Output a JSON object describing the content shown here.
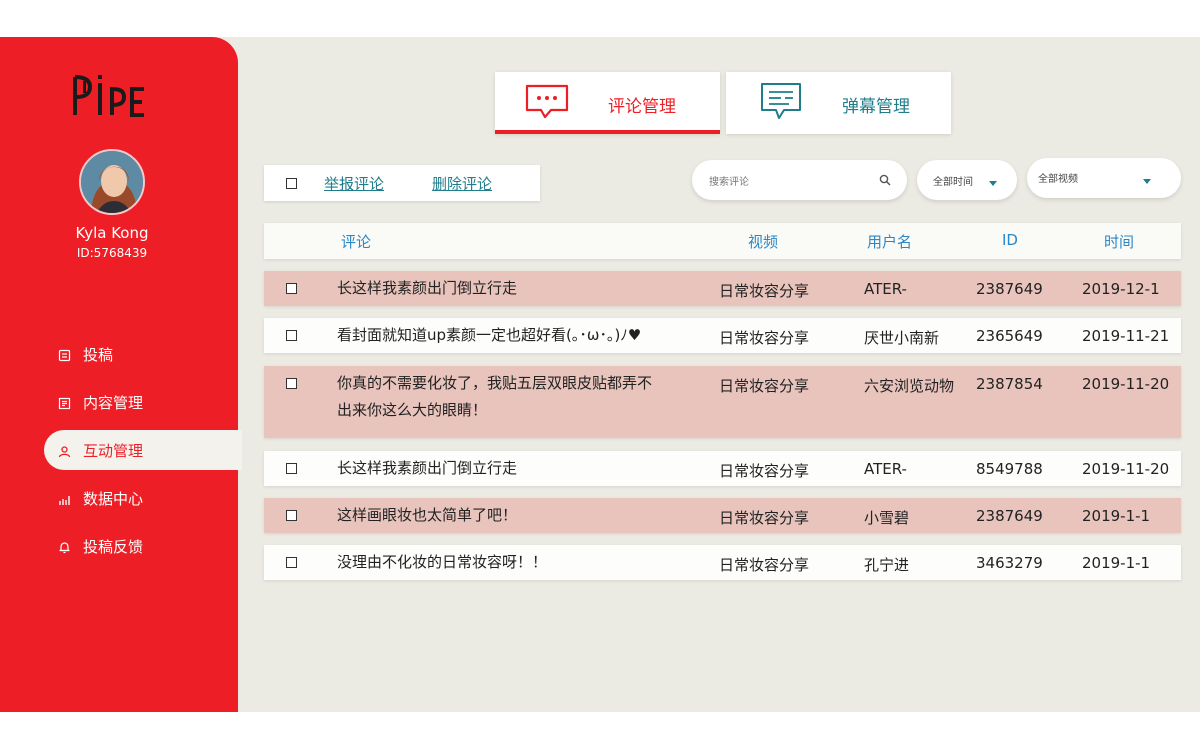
{
  "brand": {
    "logo_text": "Pipe"
  },
  "user": {
    "name": "Kyla Kong",
    "id": "ID:5768439"
  },
  "nav": {
    "items": [
      {
        "label": "投稿",
        "icon": "upload-icon"
      },
      {
        "label": "内容管理",
        "icon": "content-icon"
      },
      {
        "label": "互动管理",
        "icon": "interaction-icon",
        "active": true
      },
      {
        "label": "数据中心",
        "icon": "chart-icon"
      },
      {
        "label": "投稿反馈",
        "icon": "bell-icon"
      }
    ]
  },
  "tabs": [
    {
      "label": "评论管理",
      "icon": "comment-bubble-icon",
      "active": true
    },
    {
      "label": "弹幕管理",
      "icon": "danmaku-icon",
      "active": false
    }
  ],
  "toolbar": {
    "report_label": "举报评论",
    "delete_label": "删除评论"
  },
  "search": {
    "placeholder": "搜索评论"
  },
  "filters": {
    "time": "全部时间",
    "video": "全部视频"
  },
  "table": {
    "headers": {
      "comment": "评论",
      "video": "视频",
      "user": "用户名",
      "id": "ID",
      "time": "时间"
    },
    "rows": [
      {
        "comment": "长这样我素颜出门倒立行走",
        "video": "日常妆容分享",
        "user": "ATER-",
        "id": "2387649",
        "time": "2019-12-1"
      },
      {
        "comment": "看封面就知道up素颜一定也超好看(｡･ω･｡)ﾉ♥",
        "video": "日常妆容分享",
        "user": "厌世小南新",
        "id": "2365649",
        "time": "2019-11-21"
      },
      {
        "comment": "你真的不需要化妆了，我贴五层双眼皮贴都弄不出来你这么大的眼睛！",
        "video": "日常妆容分享",
        "user": "六安浏览动物",
        "id": "2387854",
        "time": "2019-11-20"
      },
      {
        "comment": "长这样我素颜出门倒立行走",
        "video": "日常妆容分享",
        "user": "ATER-",
        "id": "8549788",
        "time": "2019-11-20"
      },
      {
        "comment": "这样画眼妆也太简单了吧！",
        "video": "日常妆容分享",
        "user": "小雪碧",
        "id": "2387649",
        "time": "2019-1-1"
      },
      {
        "comment": "没理由不化妆的日常妆容呀！！",
        "video": "日常妆容分享",
        "user": "孔宁进",
        "id": "3463279",
        "time": "2019-1-1"
      }
    ]
  },
  "colors": {
    "accent": "#ed1e26",
    "link": "#1f7d8c",
    "header_text": "#2a88c8",
    "row_pink": "#e8c4bd",
    "background": "#ecebe3"
  }
}
